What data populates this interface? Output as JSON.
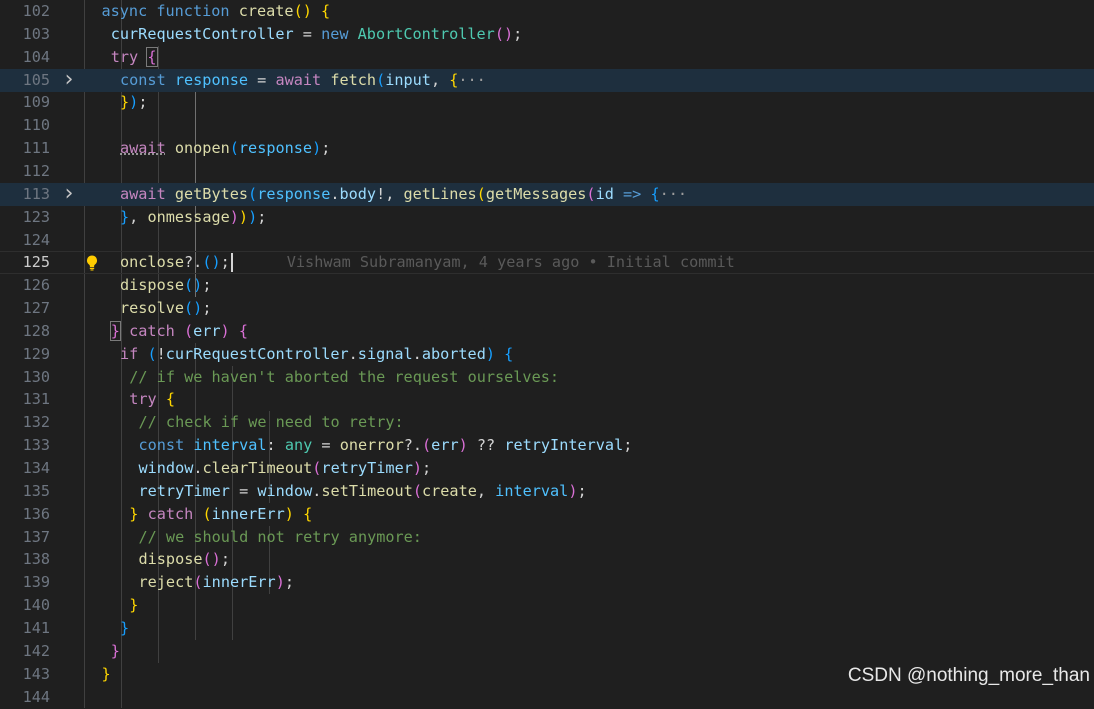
{
  "editor": {
    "active_line": "125",
    "lines": [
      {
        "n": "102",
        "tokens": [
          {
            "c": "kw",
            "t": "async"
          },
          {
            "c": "pt",
            "t": " "
          },
          {
            "c": "kw",
            "t": "function"
          },
          {
            "c": "pt",
            "t": " "
          },
          {
            "c": "fn",
            "t": "create"
          },
          {
            "c": "b1",
            "t": "()"
          },
          {
            "c": "pt",
            "t": " "
          },
          {
            "c": "b1",
            "t": "{"
          }
        ]
      },
      {
        "n": "103",
        "tokens": [
          {
            "c": "vr",
            "t": "curRequestController"
          },
          {
            "c": "pt",
            "t": " = "
          },
          {
            "c": "kw",
            "t": "new"
          },
          {
            "c": "pt",
            "t": " "
          },
          {
            "c": "ty",
            "t": "AbortController"
          },
          {
            "c": "b2",
            "t": "()"
          },
          {
            "c": "pt",
            "t": ";"
          }
        ]
      },
      {
        "n": "104",
        "tokens": [
          {
            "c": "kc",
            "t": "try"
          },
          {
            "c": "pt",
            "t": " "
          },
          {
            "c": "b2 bbox",
            "t": "{"
          }
        ]
      },
      {
        "n": "105",
        "folded": true,
        "tokens": [
          {
            "c": "kw",
            "t": "const"
          },
          {
            "c": "pt",
            "t": " "
          },
          {
            "c": "cn",
            "t": "response"
          },
          {
            "c": "pt",
            "t": " = "
          },
          {
            "c": "kc",
            "t": "await"
          },
          {
            "c": "pt",
            "t": " "
          },
          {
            "c": "fn",
            "t": "fetch"
          },
          {
            "c": "b3",
            "t": "("
          },
          {
            "c": "vr",
            "t": "input"
          },
          {
            "c": "pt",
            "t": ", "
          },
          {
            "c": "b1",
            "t": "{"
          },
          {
            "c": "ell",
            "t": "···"
          }
        ]
      },
      {
        "n": "109",
        "tokens": [
          {
            "c": "b1",
            "t": "}"
          },
          {
            "c": "b3",
            "t": ")"
          },
          {
            "c": "pt",
            "t": ";"
          }
        ]
      },
      {
        "n": "110",
        "tokens": []
      },
      {
        "n": "111",
        "tokens": [
          {
            "c": "kc squig",
            "t": "await"
          },
          {
            "c": "pt",
            "t": " "
          },
          {
            "c": "fn",
            "t": "onopen"
          },
          {
            "c": "b3",
            "t": "("
          },
          {
            "c": "cn",
            "t": "response"
          },
          {
            "c": "b3",
            "t": ")"
          },
          {
            "c": "pt",
            "t": ";"
          }
        ]
      },
      {
        "n": "112",
        "tokens": []
      },
      {
        "n": "113",
        "folded": true,
        "tokens": [
          {
            "c": "kc",
            "t": "await"
          },
          {
            "c": "pt",
            "t": " "
          },
          {
            "c": "fn",
            "t": "getBytes"
          },
          {
            "c": "b3",
            "t": "("
          },
          {
            "c": "cn",
            "t": "response"
          },
          {
            "c": "pt",
            "t": "."
          },
          {
            "c": "vr",
            "t": "body"
          },
          {
            "c": "pt",
            "t": "!, "
          },
          {
            "c": "fn",
            "t": "getLines"
          },
          {
            "c": "b1",
            "t": "("
          },
          {
            "c": "fn",
            "t": "getMessages"
          },
          {
            "c": "b2",
            "t": "("
          },
          {
            "c": "vr",
            "t": "id"
          },
          {
            "c": "pt",
            "t": " "
          },
          {
            "c": "kw",
            "t": "=>"
          },
          {
            "c": "pt",
            "t": " "
          },
          {
            "c": "b3",
            "t": "{"
          },
          {
            "c": "ell",
            "t": "···"
          }
        ]
      },
      {
        "n": "123",
        "tokens": [
          {
            "c": "b3",
            "t": "}"
          },
          {
            "c": "pt",
            "t": ", "
          },
          {
            "c": "fn",
            "t": "onmessage"
          },
          {
            "c": "b2",
            "t": ")"
          },
          {
            "c": "b1",
            "t": ")"
          },
          {
            "c": "b3",
            "t": ")"
          },
          {
            "c": "pt",
            "t": ";"
          }
        ]
      },
      {
        "n": "124",
        "tokens": []
      },
      {
        "n": "125",
        "current": true,
        "tokens": [
          {
            "c": "fn",
            "t": "onclose"
          },
          {
            "c": "pt",
            "t": "?."
          },
          {
            "c": "b3",
            "t": "()"
          },
          {
            "c": "pt",
            "t": ";"
          }
        ]
      },
      {
        "n": "126",
        "tokens": [
          {
            "c": "fn",
            "t": "dispose"
          },
          {
            "c": "b3",
            "t": "()"
          },
          {
            "c": "pt",
            "t": ";"
          }
        ]
      },
      {
        "n": "127",
        "tokens": [
          {
            "c": "fn",
            "t": "resolve"
          },
          {
            "c": "b3",
            "t": "()"
          },
          {
            "c": "pt",
            "t": ";"
          }
        ]
      },
      {
        "n": "128",
        "tokens": [
          {
            "c": "b2 bbox",
            "t": "}"
          },
          {
            "c": "pt",
            "t": " "
          },
          {
            "c": "kc",
            "t": "catch"
          },
          {
            "c": "pt",
            "t": " "
          },
          {
            "c": "b2",
            "t": "("
          },
          {
            "c": "vr",
            "t": "err"
          },
          {
            "c": "b2",
            "t": ")"
          },
          {
            "c": "pt",
            "t": " "
          },
          {
            "c": "b2",
            "t": "{"
          }
        ]
      },
      {
        "n": "129",
        "tokens": [
          {
            "c": "kc",
            "t": "if"
          },
          {
            "c": "pt",
            "t": " "
          },
          {
            "c": "b3",
            "t": "("
          },
          {
            "c": "pt",
            "t": "!"
          },
          {
            "c": "vr",
            "t": "curRequestController"
          },
          {
            "c": "pt",
            "t": "."
          },
          {
            "c": "vr",
            "t": "signal"
          },
          {
            "c": "pt",
            "t": "."
          },
          {
            "c": "vr",
            "t": "aborted"
          },
          {
            "c": "b3",
            "t": ")"
          },
          {
            "c": "pt",
            "t": " "
          },
          {
            "c": "b3",
            "t": "{"
          }
        ]
      },
      {
        "n": "130",
        "tokens": [
          {
            "c": "cm",
            "t": "// if we haven't aborted the request ourselves:"
          }
        ]
      },
      {
        "n": "131",
        "tokens": [
          {
            "c": "kc",
            "t": "try"
          },
          {
            "c": "pt",
            "t": " "
          },
          {
            "c": "b1",
            "t": "{"
          }
        ]
      },
      {
        "n": "132",
        "tokens": [
          {
            "c": "cm",
            "t": "// check if we need to retry:"
          }
        ]
      },
      {
        "n": "133",
        "tokens": [
          {
            "c": "kw",
            "t": "const"
          },
          {
            "c": "pt",
            "t": " "
          },
          {
            "c": "cn",
            "t": "interval"
          },
          {
            "c": "pt",
            "t": ": "
          },
          {
            "c": "ty",
            "t": "any"
          },
          {
            "c": "pt",
            "t": " = "
          },
          {
            "c": "fn",
            "t": "onerror"
          },
          {
            "c": "pt",
            "t": "?."
          },
          {
            "c": "b2",
            "t": "("
          },
          {
            "c": "vr",
            "t": "err"
          },
          {
            "c": "b2",
            "t": ")"
          },
          {
            "c": "pt",
            "t": " ?? "
          },
          {
            "c": "vr",
            "t": "retryInterval"
          },
          {
            "c": "pt",
            "t": ";"
          }
        ]
      },
      {
        "n": "134",
        "tokens": [
          {
            "c": "vr",
            "t": "window"
          },
          {
            "c": "pt",
            "t": "."
          },
          {
            "c": "fn",
            "t": "clearTimeout"
          },
          {
            "c": "b2",
            "t": "("
          },
          {
            "c": "vr",
            "t": "retryTimer"
          },
          {
            "c": "b2",
            "t": ")"
          },
          {
            "c": "pt",
            "t": ";"
          }
        ]
      },
      {
        "n": "135",
        "tokens": [
          {
            "c": "vr",
            "t": "retryTimer"
          },
          {
            "c": "pt",
            "t": " = "
          },
          {
            "c": "vr",
            "t": "window"
          },
          {
            "c": "pt",
            "t": "."
          },
          {
            "c": "fn",
            "t": "setTimeout"
          },
          {
            "c": "b2",
            "t": "("
          },
          {
            "c": "fn",
            "t": "create"
          },
          {
            "c": "pt",
            "t": ", "
          },
          {
            "c": "cn",
            "t": "interval"
          },
          {
            "c": "b2",
            "t": ")"
          },
          {
            "c": "pt",
            "t": ";"
          }
        ]
      },
      {
        "n": "136",
        "tokens": [
          {
            "c": "b1",
            "t": "}"
          },
          {
            "c": "pt",
            "t": " "
          },
          {
            "c": "kc",
            "t": "catch"
          },
          {
            "c": "pt",
            "t": " "
          },
          {
            "c": "b1",
            "t": "("
          },
          {
            "c": "vr",
            "t": "innerErr"
          },
          {
            "c": "b1",
            "t": ")"
          },
          {
            "c": "pt",
            "t": " "
          },
          {
            "c": "b1",
            "t": "{"
          }
        ]
      },
      {
        "n": "137",
        "tokens": [
          {
            "c": "cm",
            "t": "// we should not retry anymore:"
          }
        ]
      },
      {
        "n": "138",
        "tokens": [
          {
            "c": "fn",
            "t": "dispose"
          },
          {
            "c": "b2",
            "t": "()"
          },
          {
            "c": "pt",
            "t": ";"
          }
        ]
      },
      {
        "n": "139",
        "tokens": [
          {
            "c": "fn",
            "t": "reject"
          },
          {
            "c": "b2",
            "t": "("
          },
          {
            "c": "vr",
            "t": "innerErr"
          },
          {
            "c": "b2",
            "t": ")"
          },
          {
            "c": "pt",
            "t": ";"
          }
        ]
      },
      {
        "n": "140",
        "tokens": [
          {
            "c": "b1",
            "t": "}"
          }
        ]
      },
      {
        "n": "141",
        "tokens": [
          {
            "c": "b3",
            "t": "}"
          }
        ]
      },
      {
        "n": "142",
        "tokens": [
          {
            "c": "b2",
            "t": "}"
          }
        ]
      },
      {
        "n": "143",
        "tokens": [
          {
            "c": "b1",
            "t": "}"
          }
        ]
      },
      {
        "n": "144",
        "tokens": []
      }
    ],
    "blame": "Vishwam Subramanyam, 4 years ago • Initial commit",
    "fold_icon": "chevron-right-icon",
    "lightbulb_icon": "lightbulb-icon"
  },
  "watermark": "CSDN @nothing_more_than",
  "colors": {
    "background": "#1f1f1f",
    "line_highlight": "#1e2f3e",
    "keyword": "#569cd6",
    "control": "#c586c0",
    "function": "#dcdcaa",
    "variable": "#9cdcfe",
    "type": "#4ec9b0",
    "comment": "#6a9955"
  }
}
